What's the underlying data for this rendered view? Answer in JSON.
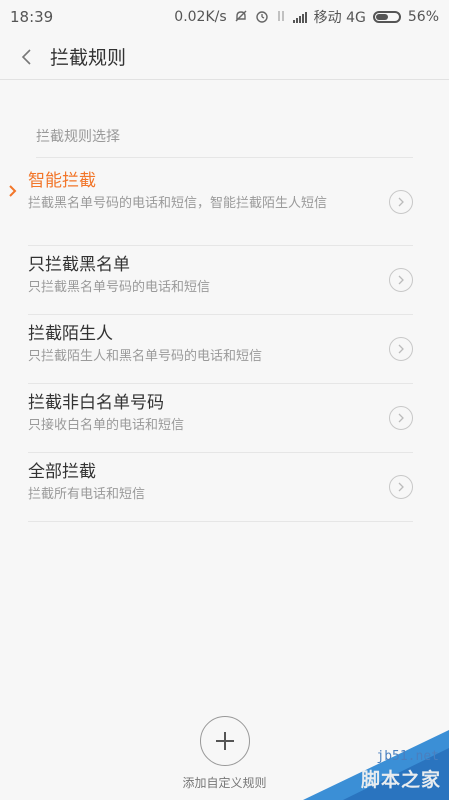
{
  "status_bar": {
    "time": "18:39",
    "speed": "0.02K/s",
    "carrier": "移动 4G",
    "battery": "56%",
    "battery_level": 0.56
  },
  "header": {
    "title": "拦截规则"
  },
  "section": {
    "label": "拦截规则选择"
  },
  "rules": [
    {
      "title": "智能拦截",
      "subtitle": "拦截黑名单号码的电话和短信，智能拦截陌生人短信",
      "selected": true
    },
    {
      "title": "只拦截黑名单",
      "subtitle": "只拦截黑名单号码的电话和短信",
      "selected": false
    },
    {
      "title": "拦截陌生人",
      "subtitle": "只拦截陌生人和黑名单号码的电话和短信",
      "selected": false
    },
    {
      "title": "拦截非白名单号码",
      "subtitle": "只接收白名单的电话和短信",
      "selected": false
    },
    {
      "title": "全部拦截",
      "subtitle": "拦截所有电话和短信",
      "selected": false
    }
  ],
  "footer": {
    "add_label": "添加自定义规则"
  },
  "watermark": {
    "domain": "jb51.net",
    "name": "脚本之家"
  },
  "colors": {
    "accent": "#f2762a",
    "background": "#f7f7f7"
  }
}
